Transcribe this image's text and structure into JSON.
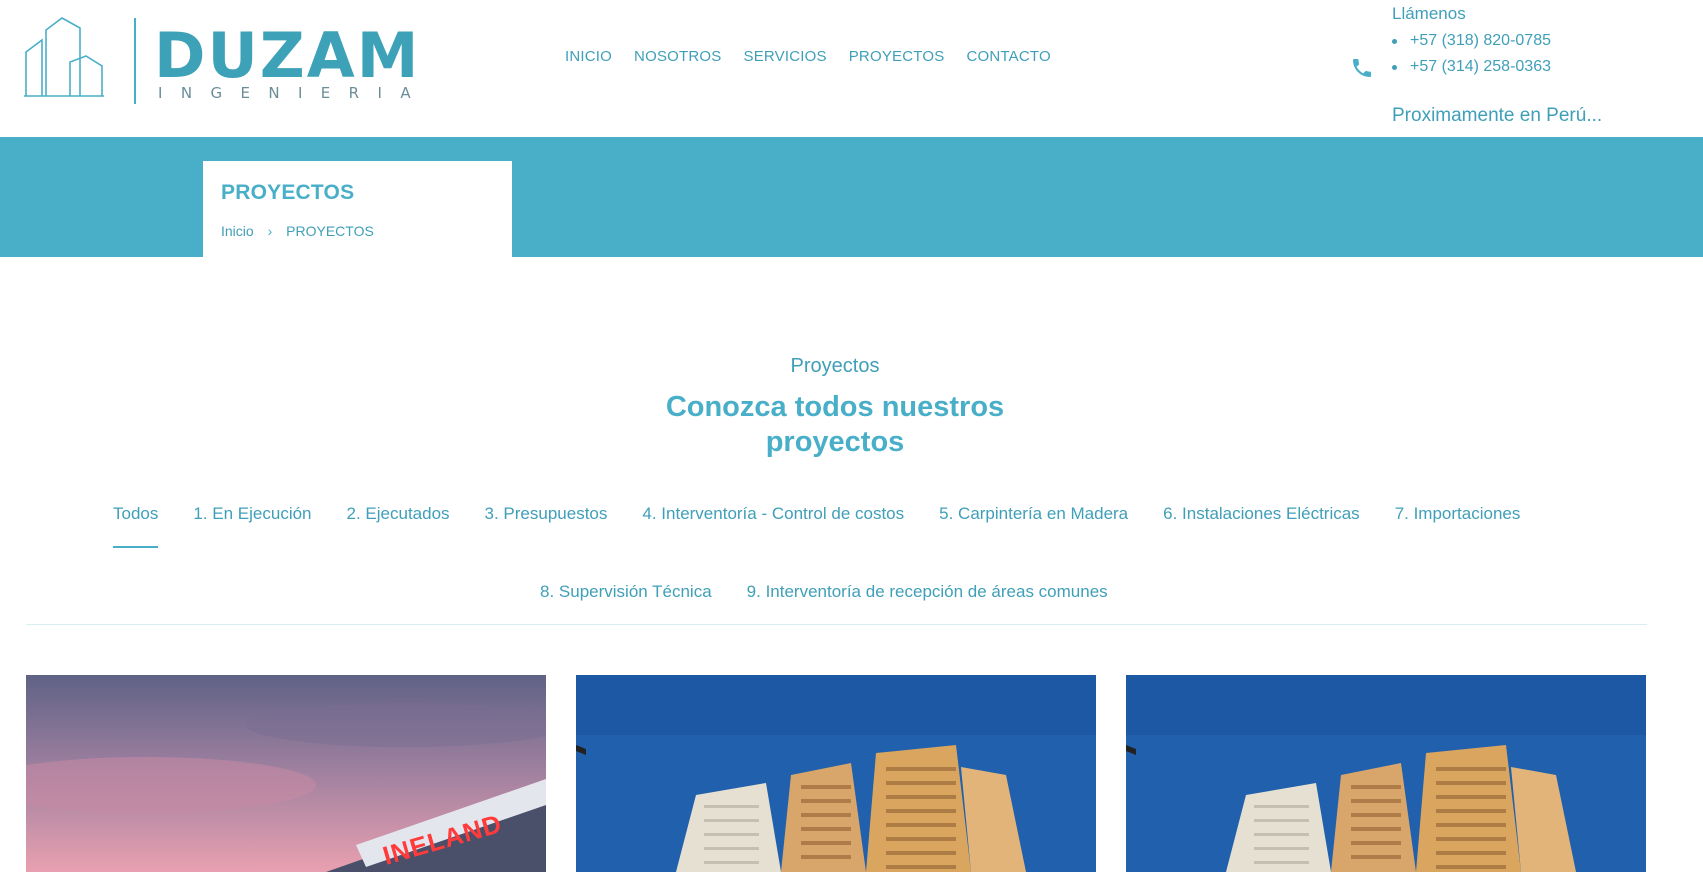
{
  "brand": {
    "name": "DUZAM",
    "tagline": "INGENIERIA"
  },
  "nav": {
    "items": [
      "INICIO",
      "NOSOTROS",
      "SERVICIOS",
      "PROYECTOS",
      "CONTACTO"
    ]
  },
  "contact": {
    "label": "Llámenos",
    "phones": [
      "+57 (318) 820-0785",
      "+57 (314) 258-0363"
    ],
    "announcement": "Proximamente en Perú..."
  },
  "banner": {
    "title": "PROYECTOS",
    "breadcrumb": {
      "home": "Inicio",
      "separator": "›",
      "current": "PROYECTOS"
    }
  },
  "section": {
    "kicker": "Proyectos",
    "title_line1": "Conozca todos nuestros",
    "title_line2": "proyectos"
  },
  "filters": {
    "active": "Todos",
    "row1": [
      "Todos",
      "1. En Ejecución",
      "2. Ejecutados",
      "3. Presupuestos",
      "4. Interventoría - Control de costos",
      "5. Carpintería en Madera",
      "6. Instalaciones Eléctricas",
      "7. Importaciones"
    ],
    "row2": [
      "8. Supervisión Técnica",
      "9. Interventoría de recepción de áreas comunes"
    ]
  },
  "cards": {
    "card1_sign": "INELAND"
  },
  "colors": {
    "accent": "#49afc9",
    "text": "#3f9fb8",
    "divider": "#d9eef3"
  }
}
